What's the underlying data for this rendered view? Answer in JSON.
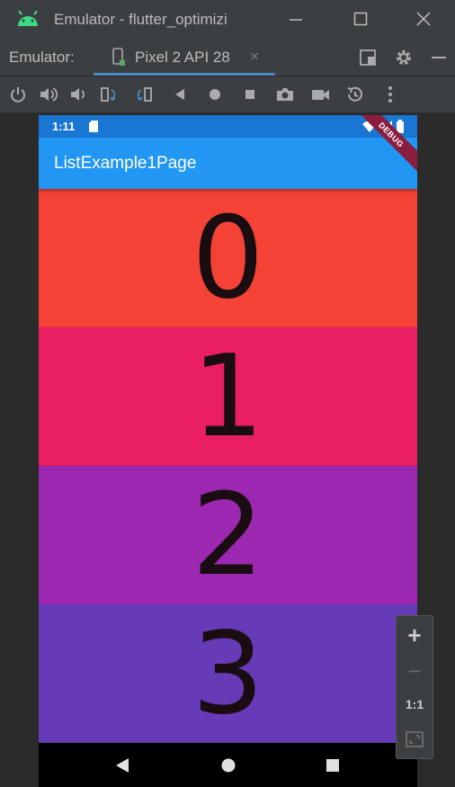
{
  "window": {
    "title": "Emulator - flutter_optimizi",
    "buttons": [
      "minimize-button",
      "maximize-button",
      "close-button"
    ]
  },
  "tool_header": {
    "label": "Emulator:",
    "tab_label": "Pixel 2 API 28",
    "tab_close": "×"
  },
  "toolbar": {
    "icons": [
      "power-icon",
      "volume-up-icon",
      "volume-down-icon",
      "rotate-left-icon",
      "rotate-right-icon",
      "back-icon",
      "home-icon",
      "overview-icon",
      "screenshot-icon",
      "screen-record-icon",
      "snapshot-icon",
      "more-icon"
    ]
  },
  "device": {
    "status_time": "1:11",
    "app_title": "ListExample1Page",
    "debug_banner": "DEBUG",
    "list_items": [
      {
        "label": "0",
        "color": "#f44336"
      },
      {
        "label": "1",
        "color": "#e91e63"
      },
      {
        "label": "2",
        "color": "#9c27b0"
      },
      {
        "label": "3",
        "color": "#673ab7"
      }
    ]
  },
  "zoom_panel": {
    "zoom_in": "+",
    "zoom_out": "−",
    "actual_size": "1:1"
  },
  "colors": {
    "ide_bg": "#3c3f41",
    "status_bar": "#1976d2",
    "app_bar": "#2196f3",
    "tab_underline": "#4a88c7"
  }
}
